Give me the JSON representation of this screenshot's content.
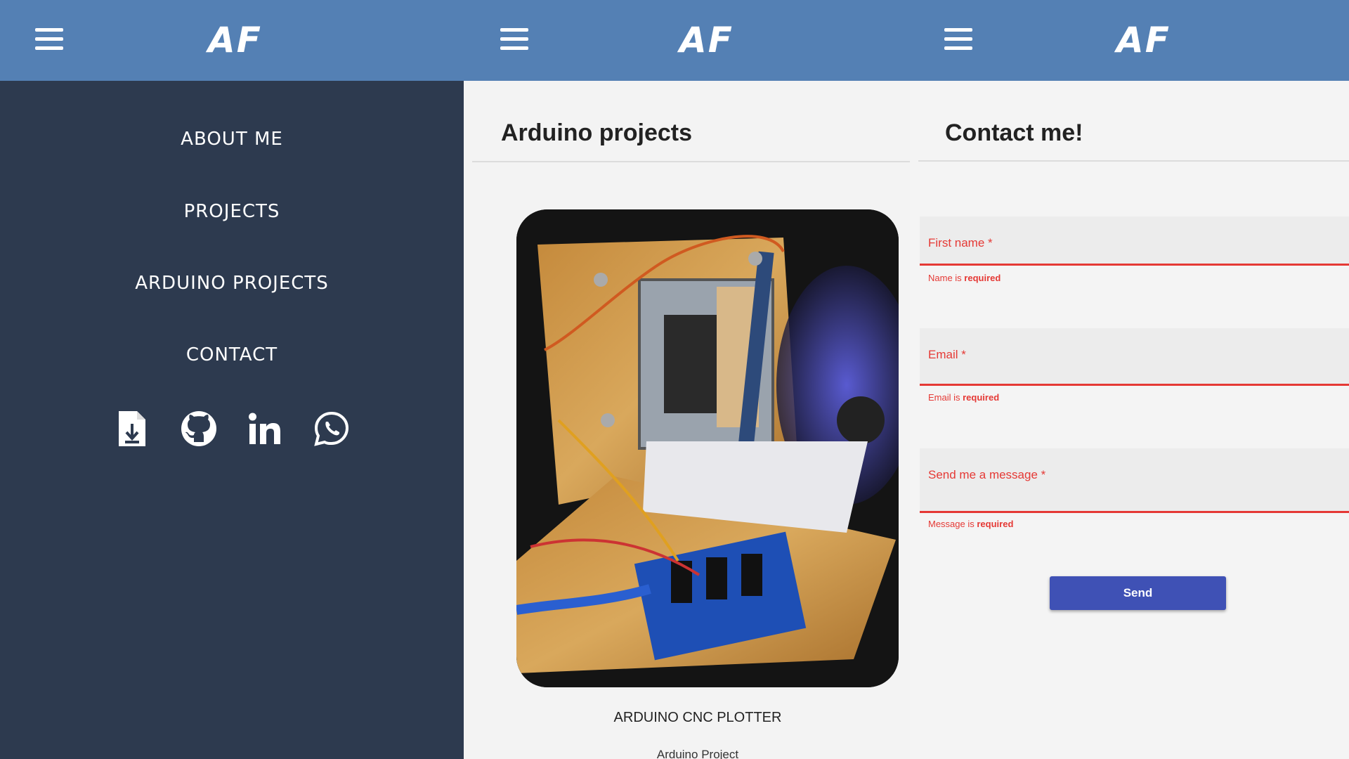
{
  "brand": {
    "logo": "AF"
  },
  "menu": {
    "items": [
      {
        "label": "ABOUT ME"
      },
      {
        "label": "PROJECTS"
      },
      {
        "label": "ARDUINO PROJECTS"
      },
      {
        "label": "CONTACT"
      }
    ],
    "social": [
      "download-file-icon",
      "github-icon",
      "linkedin-icon",
      "whatsapp-icon"
    ]
  },
  "projects": {
    "title": "Arduino projects",
    "card": {
      "title": "ARDUINO CNC PLOTTER",
      "subtitle": "Arduino Project"
    }
  },
  "contact": {
    "title": "Contact me!",
    "fields": [
      {
        "label": "First name *",
        "error_prefix": "Name is ",
        "error_bold": "required"
      },
      {
        "label": "Email *",
        "error_prefix": "Email is ",
        "error_bold": "required"
      },
      {
        "label": "Send me a message *",
        "error_prefix": "Message is ",
        "error_bold": "required"
      }
    ],
    "send_label": "Send"
  },
  "colors": {
    "header": "#5480b4",
    "sidebar": "#2d3a4f",
    "error": "#e53935",
    "button": "#3f51b5"
  }
}
